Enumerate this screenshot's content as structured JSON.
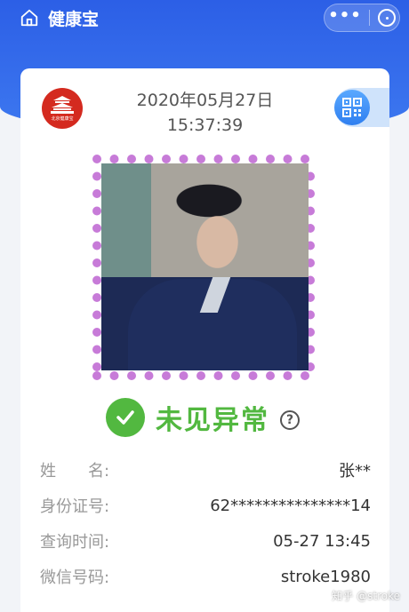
{
  "navbar": {
    "title": "健康宝"
  },
  "card": {
    "emblem_text": "北京健康宝",
    "date": "2020年05月27日",
    "time": "15:37:39"
  },
  "status": {
    "text": "未见异常",
    "help": "?"
  },
  "info": [
    {
      "label": "姓　　名:",
      "value": "张**"
    },
    {
      "label": "身份证号:",
      "value": "62***************14"
    },
    {
      "label": "查询时间:",
      "value": "05-27 13:45"
    },
    {
      "label": "微信号码:",
      "value": "stroke1980"
    }
  ],
  "watermark": "知乎 @stroke",
  "colors": {
    "header_blue": "#2c5fe6",
    "status_green": "#52b840",
    "frame_dots": "#c77bd8",
    "emblem_red": "#d42a1f"
  },
  "icons": {
    "home": "home-icon",
    "more": "more-dots-icon",
    "close": "close-target-icon",
    "qr": "qr-code-icon",
    "check": "check-icon",
    "help": "question-icon"
  }
}
